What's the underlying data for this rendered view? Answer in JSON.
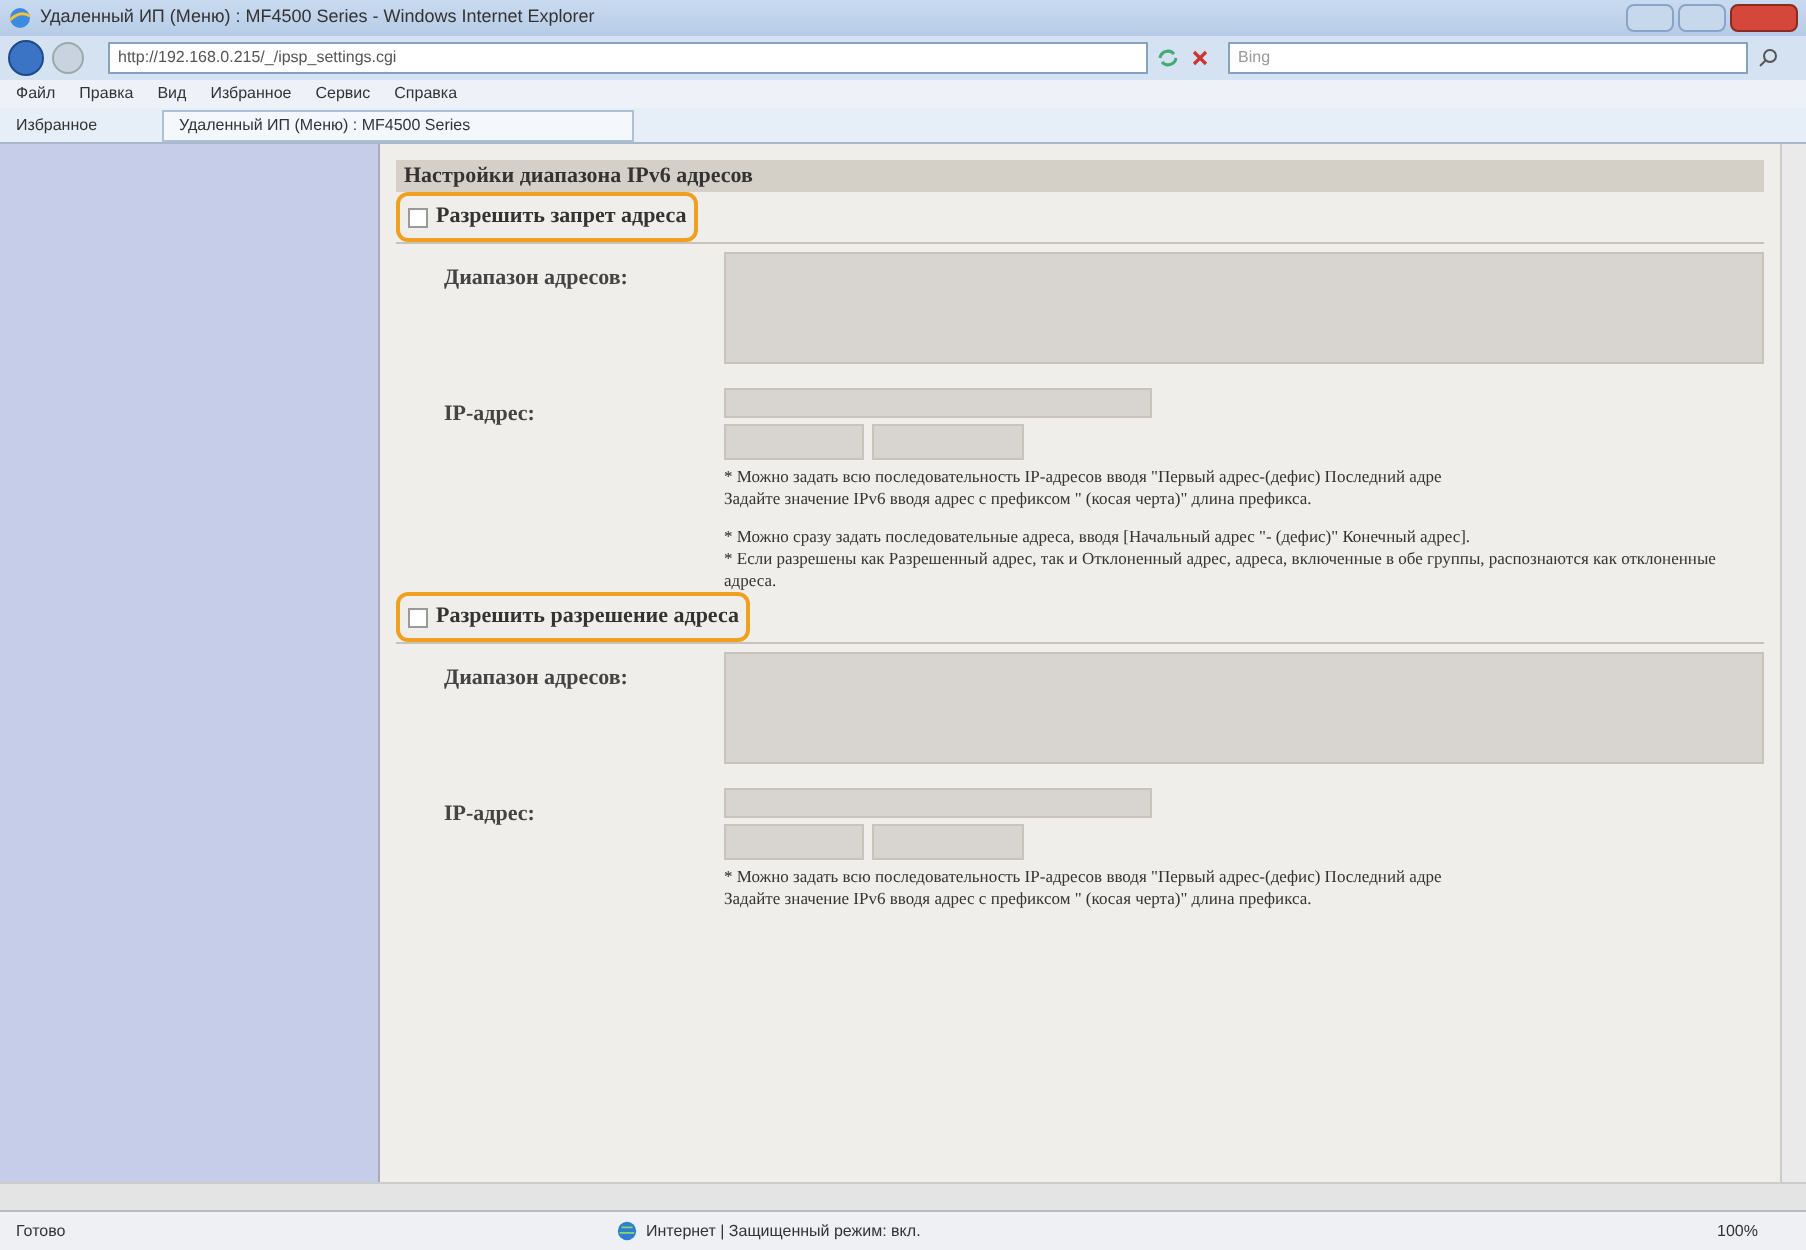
{
  "window": {
    "title": "Удаленный ИП (Меню) : MF4500 Series - Windows Internet Explorer"
  },
  "address_bar": {
    "value": "http://192.168.0.215/_/ipsp_settings.cgi"
  },
  "search": {
    "placeholder": "Bing"
  },
  "menu": [
    "Файл",
    "Правка",
    "Вид",
    "Избранное",
    "Сервис",
    "Справка"
  ],
  "favorites_bar": {
    "label": "Избранное",
    "tab": "Удаленный ИП (Меню) : MF4500 Series"
  },
  "page": {
    "heading": "Настройки диапазона IPv6 адресов",
    "sections": [
      {
        "checkbox": {
          "label": "Разрешить запрет адреса",
          "checked": false,
          "highlighted": true
        },
        "range_label": "Диапазон адресов:",
        "ip_label": "IP-адрес:",
        "disabled": true,
        "notes": [
          "* Можно задать всю последовательность IP-адресов вводя \"Первый адрес-(дефис) Последний адре",
          "Задайте значение IPv6 вводя адрес с префиксом \" (косая черта)\" длина префикса.",
          "* Можно сразу задать последовательные адреса, вводя [Начальный адрес \"- (дефис)\" Конечный адрес].",
          "* Если разрешены как Разрешенный адрес, так и Отклоненный адрес, адреса, включенные в обе группы, распознаются как отклоненные адреса."
        ]
      },
      {
        "checkbox": {
          "label": "Разрешить разрешение адреса",
          "checked": false,
          "highlighted": true
        },
        "range_label": "Диапазон адресов:",
        "ip_label": "IP-адрес:",
        "disabled": true,
        "notes": [
          "* Можно задать всю последовательность IP-адресов вводя \"Первый адрес-(дефис) Последний адре",
          "Задайте значение IPv6 вводя адрес с префиксом \" (косая черта)\" длина префикса."
        ]
      }
    ]
  },
  "status_bar": {
    "status": "Готово",
    "zone": "Интернет | Защищенный режим: вкл.",
    "zoom": "100%"
  }
}
